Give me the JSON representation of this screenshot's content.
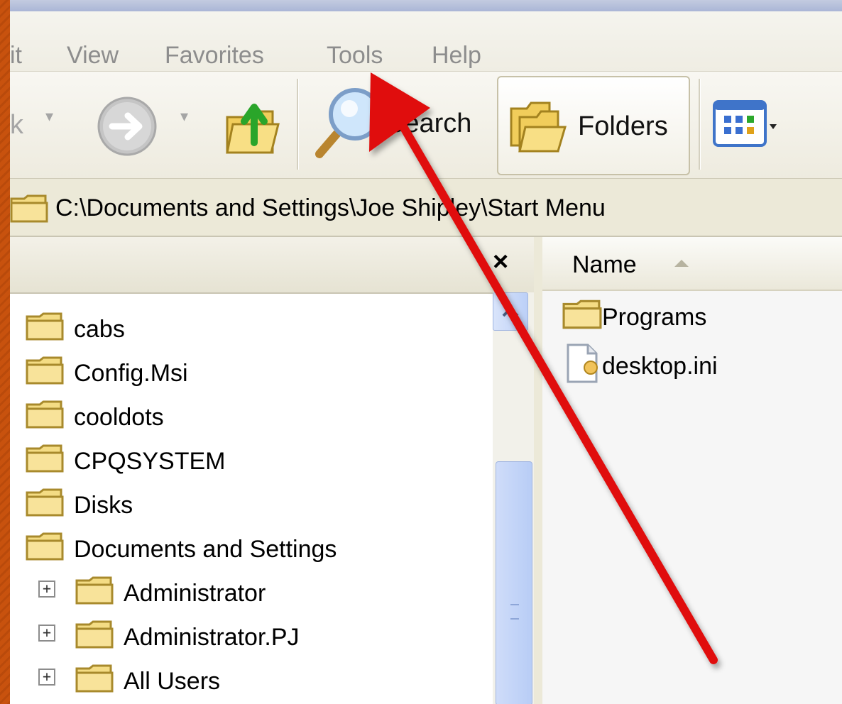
{
  "menu": {
    "edit_partial": "it",
    "view": "View",
    "favorites": "Favorites",
    "tools": "Tools",
    "help": "Help"
  },
  "toolbar": {
    "back_partial": "k",
    "search_label": "Search",
    "folders_label": "Folders"
  },
  "address": {
    "path": "C:\\Documents and Settings\\Joe Shipley\\Start Menu"
  },
  "tree": {
    "close_glyph": "×",
    "items": [
      {
        "label": "cabs"
      },
      {
        "label": "Config.Msi"
      },
      {
        "label": "cooldots"
      },
      {
        "label": "CPQSYSTEM"
      },
      {
        "label": "Disks"
      },
      {
        "label": "Documents and Settings"
      },
      {
        "label": "Administrator",
        "expander": "+"
      },
      {
        "label": "Administrator.PJ",
        "expander": "+"
      },
      {
        "label": "All Users",
        "expander": "+"
      }
    ]
  },
  "list": {
    "column_name": "Name",
    "files": [
      {
        "label": "Programs",
        "icon": "folder-icon"
      },
      {
        "label": "desktop.ini",
        "icon": "settings-file-icon"
      }
    ]
  },
  "colors": {
    "annotation_arrow": "#e0100c",
    "folder_fill": "#f4dc84",
    "folder_stroke": "#a88a2c"
  }
}
